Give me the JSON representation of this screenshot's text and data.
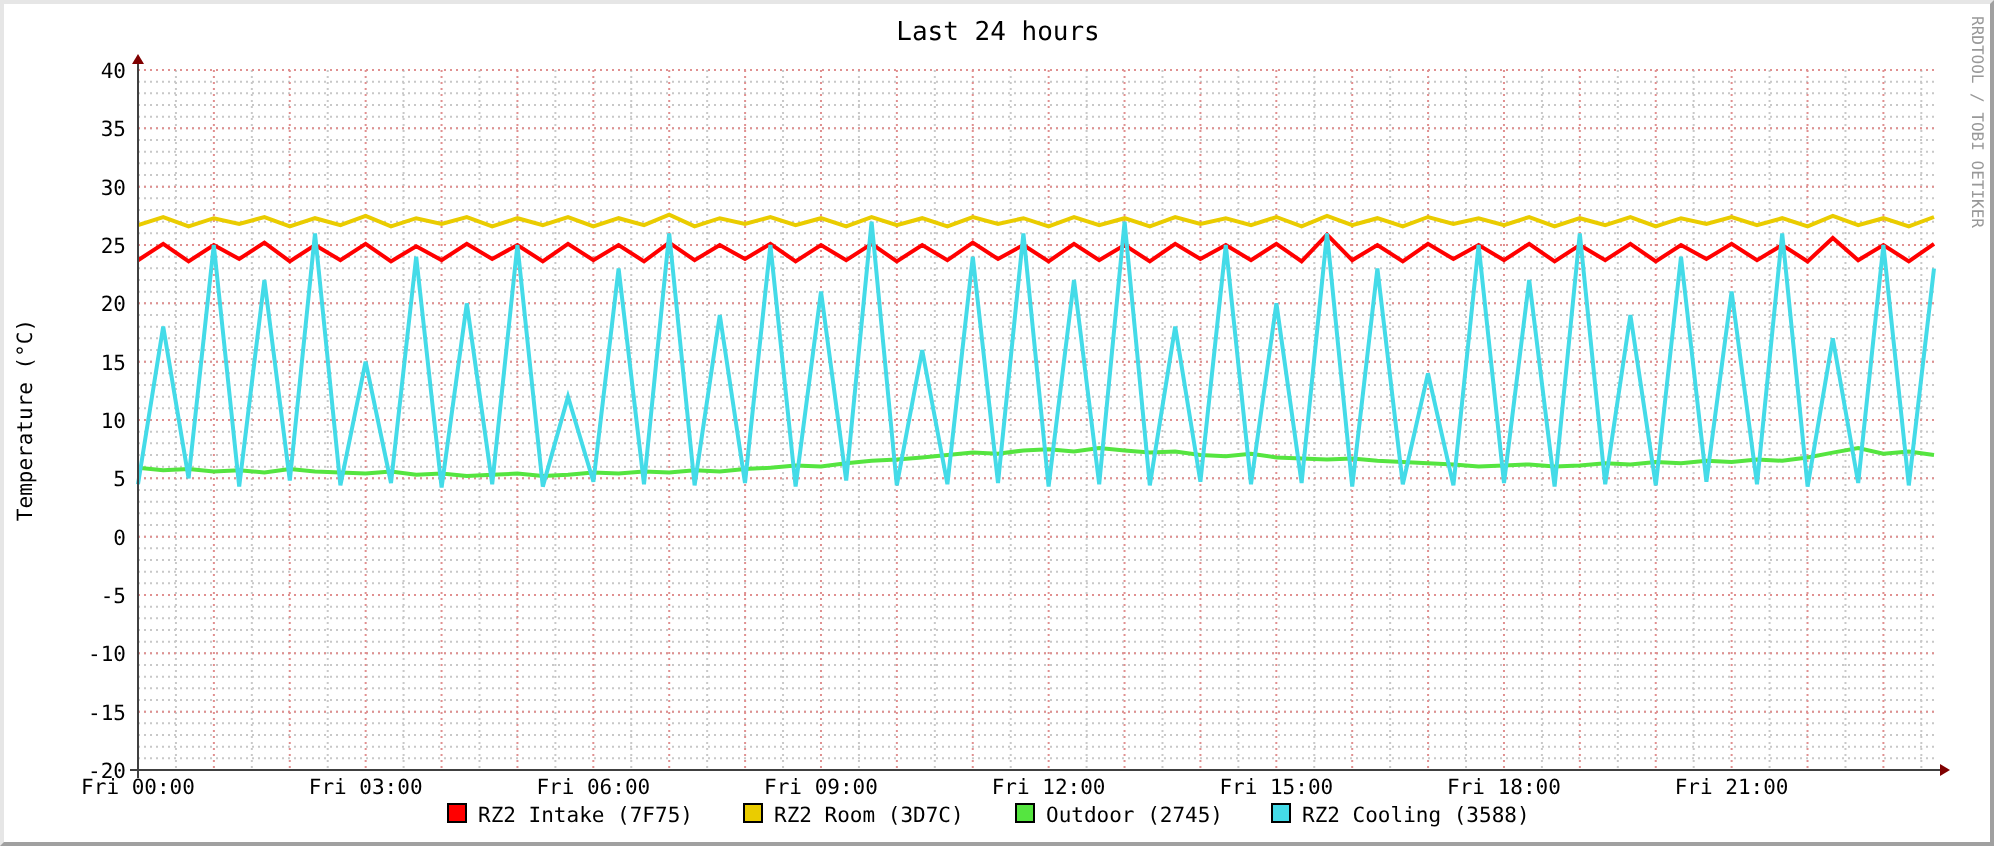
{
  "graph": {
    "credit": "RRDTOOL / TOBI OETIKER",
    "chart_data": {
      "type": "line",
      "title": "Last 24 hours",
      "ylabel": "Temperature (°C)",
      "categories": [
        "Fri 00:00",
        null,
        null,
        null,
        null,
        null,
        null,
        null,
        null,
        "Fri 03:00",
        null,
        null,
        null,
        null,
        null,
        null,
        null,
        null,
        "Fri 06:00",
        null,
        null,
        null,
        null,
        null,
        null,
        null,
        null,
        "Fri 09:00",
        null,
        null,
        null,
        null,
        null,
        null,
        null,
        null,
        "Fri 12:00",
        null,
        null,
        null,
        null,
        null,
        null,
        null,
        null,
        "Fri 15:00",
        null,
        null,
        null,
        null,
        null,
        null,
        null,
        null,
        "Fri 18:00",
        null,
        null,
        null,
        null,
        null,
        null,
        null,
        null,
        "Fri 21:00",
        null,
        null,
        null,
        null,
        null,
        null,
        null,
        null
      ],
      "ylim": [
        -20,
        40
      ],
      "grid": true,
      "legend": true,
      "yticks": [
        -20,
        -15,
        -10,
        -5,
        0,
        5,
        10,
        15,
        20,
        25,
        30,
        35,
        40
      ],
      "series": [
        {
          "name": "RZ2 Intake (7F75)",
          "color": "#ff0000",
          "values": [
            23.7,
            25.1,
            23.6,
            25.0,
            23.8,
            25.2,
            23.6,
            25.0,
            23.7,
            25.1,
            23.6,
            24.9,
            23.7,
            25.1,
            23.8,
            25.0,
            23.6,
            25.1,
            23.7,
            25.0,
            23.6,
            25.2,
            23.7,
            25.0,
            23.8,
            25.1,
            23.6,
            25.0,
            23.7,
            25.1,
            23.6,
            25.0,
            23.7,
            25.2,
            23.8,
            25.0,
            23.6,
            25.1,
            23.7,
            25.0,
            23.6,
            25.1,
            23.8,
            25.0,
            23.7,
            25.1,
            23.6,
            25.9,
            23.7,
            25.0,
            23.6,
            25.1,
            23.8,
            25.0,
            23.7,
            25.1,
            23.6,
            25.0,
            23.7,
            25.1,
            23.6,
            25.0,
            23.8,
            25.1,
            23.7,
            25.0,
            23.6,
            25.6,
            23.7,
            25.0,
            23.6,
            25.1
          ]
        },
        {
          "name": "RZ2 Room (3D7C)",
          "color": "#eacc00",
          "values": [
            26.7,
            27.4,
            26.6,
            27.3,
            26.8,
            27.4,
            26.6,
            27.3,
            26.7,
            27.5,
            26.6,
            27.3,
            26.8,
            27.4,
            26.6,
            27.3,
            26.7,
            27.4,
            26.6,
            27.3,
            26.7,
            27.6,
            26.6,
            27.3,
            26.8,
            27.4,
            26.7,
            27.3,
            26.6,
            27.4,
            26.7,
            27.3,
            26.6,
            27.4,
            26.8,
            27.3,
            26.6,
            27.4,
            26.7,
            27.3,
            26.6,
            27.4,
            26.8,
            27.3,
            26.7,
            27.4,
            26.6,
            27.5,
            26.7,
            27.3,
            26.6,
            27.4,
            26.8,
            27.3,
            26.7,
            27.4,
            26.6,
            27.3,
            26.7,
            27.4,
            26.6,
            27.3,
            26.8,
            27.4,
            26.7,
            27.3,
            26.6,
            27.5,
            26.7,
            27.3,
            26.6,
            27.4
          ]
        },
        {
          "name": "Outdoor (2745)",
          "color": "#55e540",
          "values": [
            5.9,
            5.7,
            5.8,
            5.6,
            5.7,
            5.5,
            5.8,
            5.6,
            5.5,
            5.4,
            5.6,
            5.3,
            5.4,
            5.2,
            5.3,
            5.4,
            5.2,
            5.3,
            5.5,
            5.4,
            5.6,
            5.5,
            5.7,
            5.6,
            5.8,
            5.9,
            6.1,
            6.0,
            6.3,
            6.5,
            6.6,
            6.8,
            7.0,
            7.2,
            7.1,
            7.4,
            7.5,
            7.3,
            7.6,
            7.4,
            7.2,
            7.3,
            7.0,
            6.9,
            7.1,
            6.8,
            6.7,
            6.6,
            6.7,
            6.5,
            6.4,
            6.3,
            6.2,
            6.0,
            6.1,
            6.2,
            6.0,
            6.1,
            6.3,
            6.2,
            6.4,
            6.3,
            6.5,
            6.4,
            6.6,
            6.5,
            6.8,
            7.2,
            7.6,
            7.1,
            7.3,
            7.0
          ]
        },
        {
          "name": "RZ2 Cooling (3588)",
          "color": "#44dbe8",
          "values": [
            4.5,
            18,
            5,
            25,
            4.3,
            22,
            4.8,
            26,
            4.4,
            15,
            4.6,
            24,
            4.2,
            20,
            4.5,
            25,
            4.3,
            12,
            4.7,
            23,
            4.5,
            26,
            4.4,
            19,
            4.6,
            25,
            4.3,
            21,
            4.8,
            27,
            4.4,
            16,
            4.5,
            24,
            4.6,
            26,
            4.3,
            22,
            4.5,
            27,
            4.4,
            18,
            4.7,
            25,
            4.5,
            20,
            4.6,
            26,
            4.3,
            23,
            4.5,
            14,
            4.4,
            25,
            4.6,
            22,
            4.3,
            26,
            4.5,
            19,
            4.4,
            24,
            4.7,
            21,
            4.5,
            26,
            4.3,
            17,
            4.6,
            25,
            4.4,
            23
          ]
        }
      ]
    }
  }
}
